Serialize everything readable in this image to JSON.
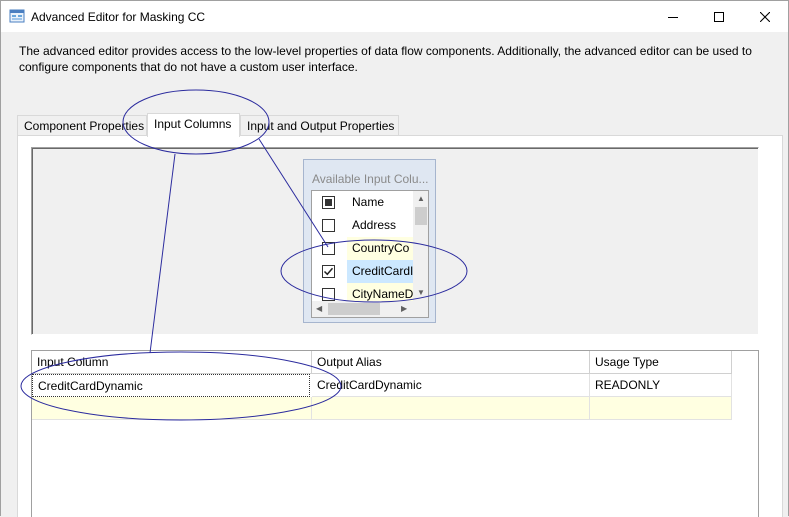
{
  "window": {
    "title": "Advanced Editor for Masking CC",
    "controls": {
      "minimize": "minimize",
      "maximize": "maximize",
      "close": "close"
    }
  },
  "description": "The advanced editor provides access to the low-level properties of data flow components. Additionally, the advanced editor can be used to configure components that do not have a custom user interface.",
  "tabs": [
    {
      "label": "Component Properties",
      "active": false
    },
    {
      "label": "Input Columns",
      "active": true
    },
    {
      "label": "Input and Output Properties",
      "active": false
    }
  ],
  "available": {
    "title": "Available Input Colu...",
    "header": {
      "label": "Name",
      "state": "partial"
    },
    "columns": [
      {
        "label": "Address",
        "checked": false,
        "selected": false
      },
      {
        "label": "CountryCo",
        "checked": false,
        "selected": false
      },
      {
        "label": "CreditCardI",
        "checked": true,
        "selected": true
      },
      {
        "label": "CityNameD",
        "checked": false,
        "selected": false
      }
    ]
  },
  "grid": {
    "headers": [
      "Input Column",
      "Output Alias",
      "Usage Type"
    ],
    "rows": [
      {
        "input_column": "CreditCardDynamic",
        "output_alias": "CreditCardDynamic",
        "usage_type": "READONLY"
      }
    ]
  },
  "colors": {
    "selection": "#cce8ff",
    "new_row": "#ffffe1",
    "annotation": "#2b2b9e",
    "panel_frame": "#dfe7f2"
  }
}
